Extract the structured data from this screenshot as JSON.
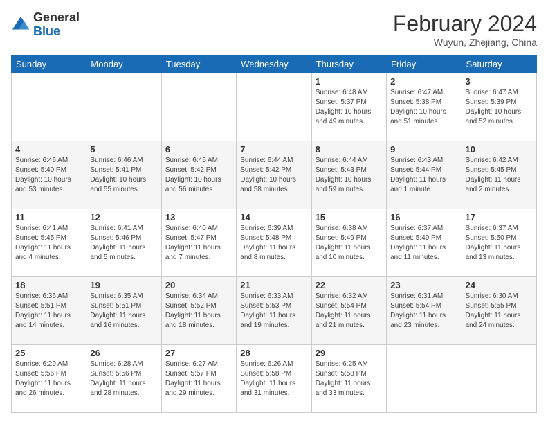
{
  "header": {
    "logo_general": "General",
    "logo_blue": "Blue",
    "month_year": "February 2024",
    "location": "Wuyun, Zhejiang, China"
  },
  "days_of_week": [
    "Sunday",
    "Monday",
    "Tuesday",
    "Wednesday",
    "Thursday",
    "Friday",
    "Saturday"
  ],
  "weeks": [
    [
      {
        "day": "",
        "info": ""
      },
      {
        "day": "",
        "info": ""
      },
      {
        "day": "",
        "info": ""
      },
      {
        "day": "",
        "info": ""
      },
      {
        "day": "1",
        "info": "Sunrise: 6:48 AM\nSunset: 5:37 PM\nDaylight: 10 hours and 49 minutes."
      },
      {
        "day": "2",
        "info": "Sunrise: 6:47 AM\nSunset: 5:38 PM\nDaylight: 10 hours and 51 minutes."
      },
      {
        "day": "3",
        "info": "Sunrise: 6:47 AM\nSunset: 5:39 PM\nDaylight: 10 hours and 52 minutes."
      }
    ],
    [
      {
        "day": "4",
        "info": "Sunrise: 6:46 AM\nSunset: 5:40 PM\nDaylight: 10 hours and 53 minutes."
      },
      {
        "day": "5",
        "info": "Sunrise: 6:46 AM\nSunset: 5:41 PM\nDaylight: 10 hours and 55 minutes."
      },
      {
        "day": "6",
        "info": "Sunrise: 6:45 AM\nSunset: 5:42 PM\nDaylight: 10 hours and 56 minutes."
      },
      {
        "day": "7",
        "info": "Sunrise: 6:44 AM\nSunset: 5:42 PM\nDaylight: 10 hours and 58 minutes."
      },
      {
        "day": "8",
        "info": "Sunrise: 6:44 AM\nSunset: 5:43 PM\nDaylight: 10 hours and 59 minutes."
      },
      {
        "day": "9",
        "info": "Sunrise: 6:43 AM\nSunset: 5:44 PM\nDaylight: 11 hours and 1 minute."
      },
      {
        "day": "10",
        "info": "Sunrise: 6:42 AM\nSunset: 5:45 PM\nDaylight: 11 hours and 2 minutes."
      }
    ],
    [
      {
        "day": "11",
        "info": "Sunrise: 6:41 AM\nSunset: 5:45 PM\nDaylight: 11 hours and 4 minutes."
      },
      {
        "day": "12",
        "info": "Sunrise: 6:41 AM\nSunset: 5:46 PM\nDaylight: 11 hours and 5 minutes."
      },
      {
        "day": "13",
        "info": "Sunrise: 6:40 AM\nSunset: 5:47 PM\nDaylight: 11 hours and 7 minutes."
      },
      {
        "day": "14",
        "info": "Sunrise: 6:39 AM\nSunset: 5:48 PM\nDaylight: 11 hours and 8 minutes."
      },
      {
        "day": "15",
        "info": "Sunrise: 6:38 AM\nSunset: 5:49 PM\nDaylight: 11 hours and 10 minutes."
      },
      {
        "day": "16",
        "info": "Sunrise: 6:37 AM\nSunset: 5:49 PM\nDaylight: 11 hours and 11 minutes."
      },
      {
        "day": "17",
        "info": "Sunrise: 6:37 AM\nSunset: 5:50 PM\nDaylight: 11 hours and 13 minutes."
      }
    ],
    [
      {
        "day": "18",
        "info": "Sunrise: 6:36 AM\nSunset: 5:51 PM\nDaylight: 11 hours and 14 minutes."
      },
      {
        "day": "19",
        "info": "Sunrise: 6:35 AM\nSunset: 5:51 PM\nDaylight: 11 hours and 16 minutes."
      },
      {
        "day": "20",
        "info": "Sunrise: 6:34 AM\nSunset: 5:52 PM\nDaylight: 11 hours and 18 minutes."
      },
      {
        "day": "21",
        "info": "Sunrise: 6:33 AM\nSunset: 5:53 PM\nDaylight: 11 hours and 19 minutes."
      },
      {
        "day": "22",
        "info": "Sunrise: 6:32 AM\nSunset: 5:54 PM\nDaylight: 11 hours and 21 minutes."
      },
      {
        "day": "23",
        "info": "Sunrise: 6:31 AM\nSunset: 5:54 PM\nDaylight: 11 hours and 23 minutes."
      },
      {
        "day": "24",
        "info": "Sunrise: 6:30 AM\nSunset: 5:55 PM\nDaylight: 11 hours and 24 minutes."
      }
    ],
    [
      {
        "day": "25",
        "info": "Sunrise: 6:29 AM\nSunset: 5:56 PM\nDaylight: 11 hours and 26 minutes."
      },
      {
        "day": "26",
        "info": "Sunrise: 6:28 AM\nSunset: 5:56 PM\nDaylight: 11 hours and 28 minutes."
      },
      {
        "day": "27",
        "info": "Sunrise: 6:27 AM\nSunset: 5:57 PM\nDaylight: 11 hours and 29 minutes."
      },
      {
        "day": "28",
        "info": "Sunrise: 6:26 AM\nSunset: 5:58 PM\nDaylight: 11 hours and 31 minutes."
      },
      {
        "day": "29",
        "info": "Sunrise: 6:25 AM\nSunset: 5:58 PM\nDaylight: 11 hours and 33 minutes."
      },
      {
        "day": "",
        "info": ""
      },
      {
        "day": "",
        "info": ""
      }
    ]
  ],
  "accent_color": "#1a6bb5"
}
